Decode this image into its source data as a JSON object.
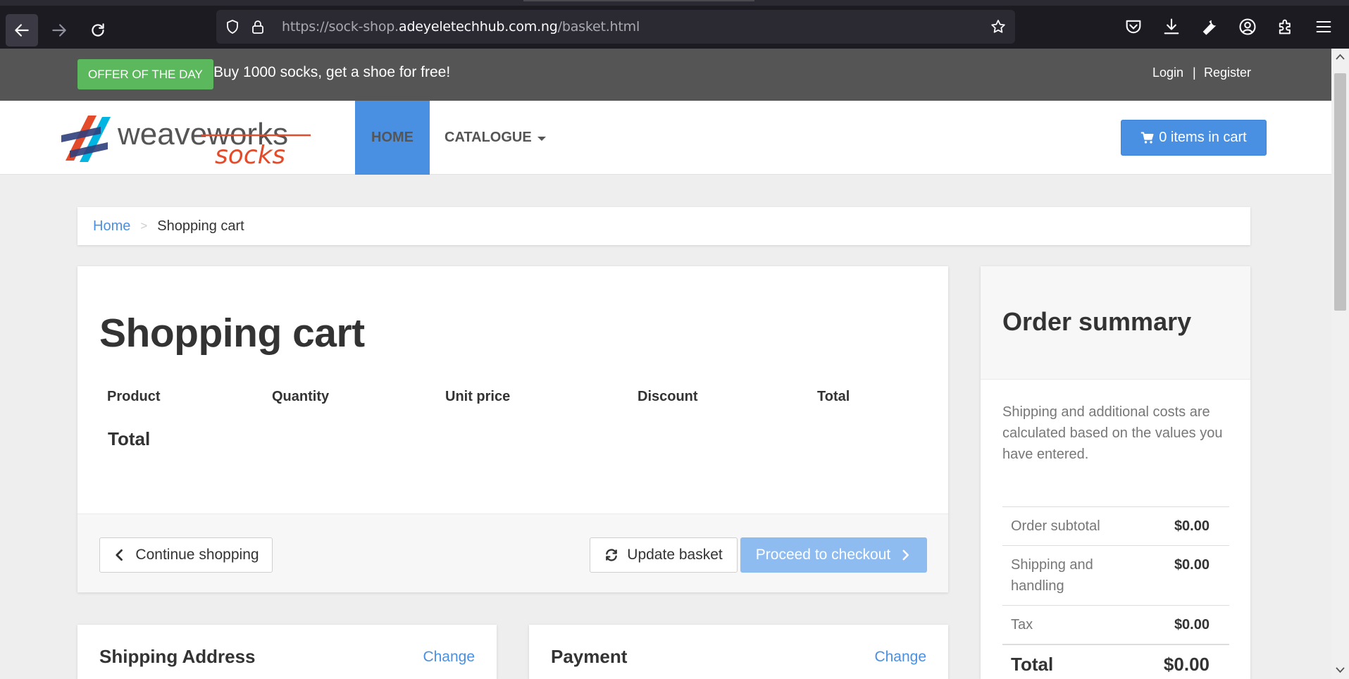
{
  "browser": {
    "url_prefix": "https://sock-shop.",
    "url_host": "adeyeletechhub.com.ng",
    "url_path": "/basket.html"
  },
  "offer": {
    "badge": "OFFER OF THE DAY",
    "text": "Buy 1000 socks, get a shoe for free!"
  },
  "auth": {
    "login": "Login",
    "separator": "|",
    "register": "Register"
  },
  "nav": {
    "home": "HOME",
    "catalogue": "CATALOGUE"
  },
  "cart_button": {
    "label": "0 items in cart"
  },
  "breadcrumb": {
    "home": "Home",
    "separator": ">",
    "current": "Shopping cart"
  },
  "cart": {
    "title": "Shopping cart",
    "columns": [
      "Product",
      "Quantity",
      "Unit price",
      "Discount",
      "Total"
    ],
    "total_label": "Total",
    "continue_label": "Continue shopping",
    "update_label": "Update basket",
    "checkout_label": "Proceed to checkout"
  },
  "shipping": {
    "title": "Shipping Address",
    "change": "Change"
  },
  "payment": {
    "title": "Payment",
    "change": "Change"
  },
  "summary": {
    "title": "Order summary",
    "note": "Shipping and additional costs are calculated based on the values you have entered.",
    "rows": [
      {
        "label": "Order subtotal",
        "value": "$0.00"
      },
      {
        "label": "Shipping and handling",
        "value": "$0.00"
      },
      {
        "label": "Tax",
        "value": "$0.00"
      },
      {
        "label": "Total",
        "value": "$0.00"
      }
    ]
  },
  "colors": {
    "accent": "#4a90e2",
    "offer_green": "#5cb85c",
    "checkout_disabled": "#8fbcf0"
  },
  "logo": {
    "text_top": "weaveworks",
    "text_bottom": "socks"
  }
}
